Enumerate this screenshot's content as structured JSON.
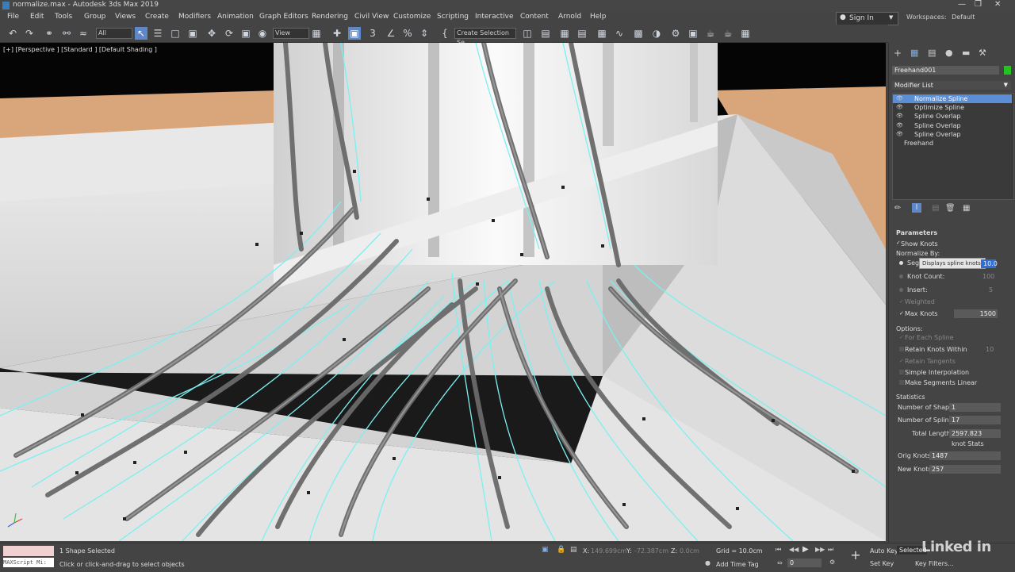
{
  "title": {
    "text": "normalize.max - Autodesk 3ds Max 2019"
  },
  "window_controls": {
    "minimize": "—",
    "maximize": "❐",
    "close": "✕"
  },
  "menu": [
    "File",
    "Edit",
    "Tools",
    "Group",
    "Views",
    "Create",
    "Modifiers",
    "Animation",
    "Graph Editors",
    "Rendering",
    "Civil View",
    "Customize",
    "Scripting",
    "Interactive",
    "Content",
    "Arnold",
    "Help"
  ],
  "signin": {
    "label": "Sign In"
  },
  "workspaces": {
    "label": "Workspaces:",
    "value": "Default"
  },
  "toolbar": {
    "filter_value": "All",
    "view_value": "View",
    "selection_set_placeholder": "Create Selection Se",
    "icons": [
      "undo-icon",
      "redo-icon",
      "link-icon",
      "unlink-icon",
      "bind-spacewarp-icon",
      "select-object-icon",
      "select-by-name-icon",
      "rect-region-icon",
      "window-crossing-icon",
      "select-move-icon",
      "select-rotate-icon",
      "select-scale-icon",
      "place-icon",
      "pivot-icon",
      "keyboard-shortcut-icon",
      "snaps-3d-icon",
      "angle-snap-icon",
      "percent-snap-icon",
      "spinner-snap-icon",
      "edit-named-sel-icon",
      "mirror-icon",
      "align-icon",
      "scene-explorer-icon",
      "layer-explorer-icon",
      "ribbon-icon",
      "curve-editor-icon",
      "schematic-icon",
      "material-editor-icon",
      "render-setup-icon",
      "rendered-frame-icon",
      "render-icon",
      "arnold-icon"
    ]
  },
  "viewport": {
    "label": "[+] [Perspective ] [Standard ] [Default Shading ]"
  },
  "command_panel": {
    "object_name": "Freehand001",
    "object_color": "#1fc41f",
    "modifier_list_label": "Modifier List",
    "stack": [
      {
        "name": "Normalize Spline",
        "selected": true,
        "eye": true
      },
      {
        "name": "Optimize Spline",
        "selected": false,
        "eye": true
      },
      {
        "name": "Spline Overlap",
        "selected": false,
        "eye": true
      },
      {
        "name": "Spline Overlap",
        "selected": false,
        "eye": true
      },
      {
        "name": "Spline Overlap",
        "selected": false,
        "eye": true
      },
      {
        "name": "Freehand",
        "selected": false,
        "eye": false
      }
    ],
    "parameters": {
      "header": "Parameters",
      "show_knots": "Show Knots",
      "normalize_by": "Normalize By:",
      "segment_label": "Seg",
      "tooltip": "Displays spline knots.",
      "segment_value": "10.0",
      "knot_count_label": "Knot Count:",
      "knot_count_value": "100",
      "insert_label": "Insert:",
      "insert_value": "5",
      "weighted_label": "Weighted",
      "max_knots_label": "Max Knots",
      "max_knots_value": "1500",
      "options_label": "Options:",
      "for_each_spline": "For Each Spline",
      "retain_knots_within": "Retain Knots Within",
      "retain_knots_value": "10",
      "retain_tangents": "Retain Tangents",
      "simple_interpolation": "Simple Interpolation",
      "make_segments_linear": "Make Segments Linear",
      "statistics_label": "Statistics",
      "num_shapes_label": "Number of Shapes:",
      "num_shapes_value": "1",
      "num_splines_label": "Number of Splines:",
      "num_splines_value": "17",
      "total_length_label": "Total Length:",
      "total_length_value": "2597.823",
      "knot_stats_label": "knot Stats",
      "orig_knots_label": "Orig Knots:",
      "orig_knots_value": "1487",
      "new_knots_label": "New Knots:",
      "new_knots_value": "257"
    }
  },
  "status": {
    "maxscript_label": "MAXScript Mi:",
    "selection": "1 Shape Selected",
    "prompt": "Click or click-and-drag to select objects",
    "x_label": "X:",
    "x_value": "149.699cm",
    "y_label": "Y:",
    "y_value": "-72.387cm",
    "z_label": "Z:",
    "z_value": "0.0cm",
    "grid": "Grid = 10.0cm",
    "add_time_tag": "Add Time Tag",
    "auto_key": "Auto Key",
    "selected": "Selected",
    "set_key": "Set Key",
    "key_filters": "Key Filters...",
    "frame": "0",
    "watermark": "Linked in"
  }
}
